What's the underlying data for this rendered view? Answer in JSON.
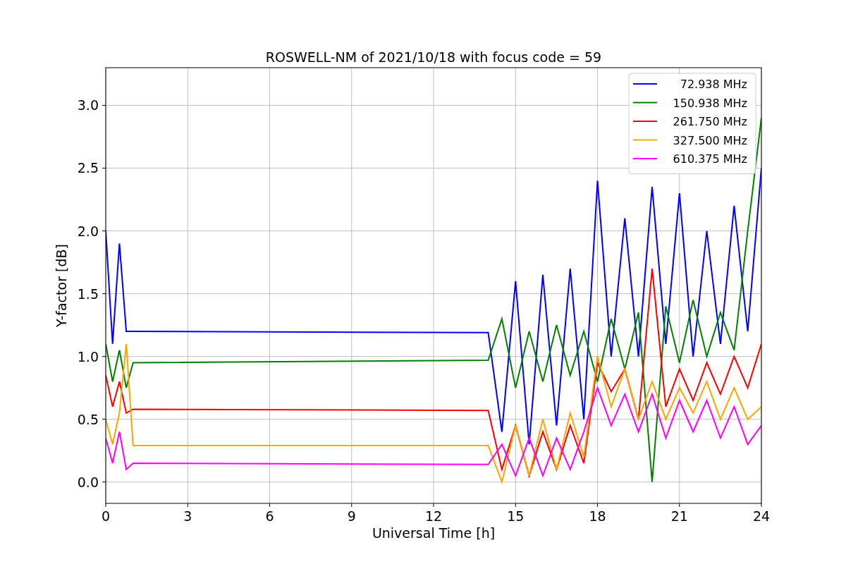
{
  "chart_data": {
    "type": "line",
    "title": "ROSWELL-NM of 2021/10/18 with focus code = 59",
    "xlabel": "Universal Time [h]",
    "ylabel": "Y-factor [dB]",
    "x": [
      0,
      0.25,
      0.5,
      0.75,
      1,
      14,
      14.5,
      15,
      15.5,
      16,
      16.5,
      17,
      17.5,
      18,
      18.5,
      19,
      19.5,
      20,
      20.5,
      21,
      21.5,
      22,
      22.5,
      23,
      23.5,
      24
    ],
    "series": [
      {
        "name": " 72.938 MHz",
        "color": "#0000ff",
        "values": [
          2.0,
          1.1,
          1.9,
          1.2,
          1.2,
          1.19,
          0.4,
          1.6,
          0.3,
          1.65,
          0.45,
          1.7,
          0.5,
          2.4,
          1.0,
          2.1,
          1.0,
          2.35,
          1.1,
          2.3,
          1.0,
          2.0,
          1.1,
          2.2,
          1.2,
          2.5
        ]
      },
      {
        "name": "150.938 MHz",
        "color": "#008000",
        "values": [
          1.1,
          0.8,
          1.05,
          0.75,
          0.95,
          0.97,
          1.3,
          0.75,
          1.2,
          0.8,
          1.25,
          0.85,
          1.2,
          0.8,
          1.3,
          0.9,
          1.35,
          0.0,
          1.4,
          0.95,
          1.45,
          1.0,
          1.35,
          1.05,
          2.0,
          2.9
        ]
      },
      {
        "name": "261.750 MHz",
        "color": "#ff0000",
        "values": [
          0.85,
          0.6,
          0.8,
          0.55,
          0.58,
          0.57,
          0.1,
          0.45,
          0.05,
          0.4,
          0.1,
          0.45,
          0.15,
          0.95,
          0.72,
          0.9,
          0.5,
          1.7,
          0.6,
          0.9,
          0.65,
          0.95,
          0.7,
          1.0,
          0.75,
          1.1
        ]
      },
      {
        "name": "327.500 MHz",
        "color": "#ffa500",
        "values": [
          0.5,
          0.3,
          0.55,
          1.1,
          0.29,
          0.29,
          0.0,
          0.45,
          0.05,
          0.5,
          0.1,
          0.55,
          0.2,
          1.0,
          0.6,
          0.9,
          0.5,
          0.8,
          0.5,
          0.75,
          0.55,
          0.8,
          0.5,
          0.75,
          0.5,
          0.6
        ]
      },
      {
        "name": "610.375 MHz",
        "color": "#ff00ff",
        "values": [
          0.35,
          0.15,
          0.4,
          0.1,
          0.15,
          0.14,
          0.3,
          0.05,
          0.35,
          0.05,
          0.35,
          0.1,
          0.4,
          0.75,
          0.45,
          0.7,
          0.4,
          0.7,
          0.35,
          0.65,
          0.4,
          0.65,
          0.35,
          0.6,
          0.3,
          0.45
        ]
      }
    ],
    "xlim": [
      0,
      24
    ],
    "ylim": [
      -0.17,
      3.3
    ],
    "grid": true,
    "legend": true,
    "xticks": [
      0,
      3,
      6,
      9,
      12,
      15,
      18,
      21,
      24
    ],
    "yticks": [
      {
        "value": 0,
        "label": "0.0"
      },
      {
        "value": 0.5,
        "label": "0.5"
      },
      {
        "value": 1,
        "label": "1.0"
      },
      {
        "value": 1.5,
        "label": "1.5"
      },
      {
        "value": 2,
        "label": "2.0"
      },
      {
        "value": 2.5,
        "label": "2.5"
      },
      {
        "value": 3,
        "label": "3.0"
      }
    ]
  }
}
